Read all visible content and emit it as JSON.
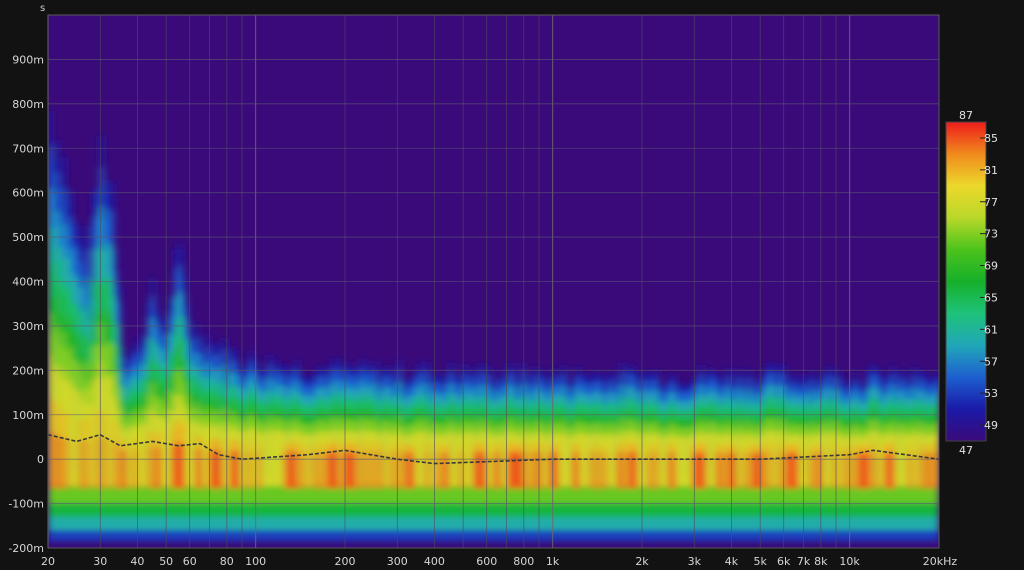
{
  "chart_data": {
    "type": "heatmap",
    "title": "",
    "y_unit": "s",
    "x_unit": "kHz",
    "xscale": "log",
    "xlim": [
      20,
      20000
    ],
    "ylim": [
      -0.2,
      1.0
    ],
    "grid": true,
    "x_ticks": [
      {
        "value": 20,
        "label": "20"
      },
      {
        "value": 30,
        "label": "30"
      },
      {
        "value": 40,
        "label": "40"
      },
      {
        "value": 50,
        "label": "50"
      },
      {
        "value": 60,
        "label": "60"
      },
      {
        "value": 80,
        "label": "80"
      },
      {
        "value": 100,
        "label": "100"
      },
      {
        "value": 200,
        "label": "200"
      },
      {
        "value": 300,
        "label": "300"
      },
      {
        "value": 400,
        "label": "400"
      },
      {
        "value": 600,
        "label": "600"
      },
      {
        "value": 800,
        "label": "800"
      },
      {
        "value": 1000,
        "label": "1k"
      },
      {
        "value": 2000,
        "label": "2k"
      },
      {
        "value": 3000,
        "label": "3k"
      },
      {
        "value": 4000,
        "label": "4k"
      },
      {
        "value": 5000,
        "label": "5k"
      },
      {
        "value": 6000,
        "label": "6k"
      },
      {
        "value": 7000,
        "label": "7k"
      },
      {
        "value": 8000,
        "label": "8k"
      },
      {
        "value": 10000,
        "label": "10k"
      },
      {
        "value": 20000,
        "label": "20kHz"
      }
    ],
    "y_ticks": [
      {
        "value": 0.9,
        "label": "900m"
      },
      {
        "value": 0.8,
        "label": "800m"
      },
      {
        "value": 0.7,
        "label": "700m"
      },
      {
        "value": 0.6,
        "label": "600m"
      },
      {
        "value": 0.5,
        "label": "500m"
      },
      {
        "value": 0.4,
        "label": "400m"
      },
      {
        "value": 0.3,
        "label": "300m"
      },
      {
        "value": 0.2,
        "label": "200m"
      },
      {
        "value": 0.1,
        "label": "100m"
      },
      {
        "value": 0.0,
        "label": "0"
      },
      {
        "value": -0.1,
        "label": "-100m"
      },
      {
        "value": -0.2,
        "label": "-200m"
      }
    ],
    "color_scale": {
      "min": 47,
      "max": 87,
      "labels": [
        "87",
        "85",
        "81",
        "77",
        "73",
        "69",
        "65",
        "61",
        "57",
        "53",
        "49",
        "47"
      ],
      "stops": [
        {
          "value": 47,
          "color": "#3a0a7a"
        },
        {
          "value": 51,
          "color": "#1a1aa8"
        },
        {
          "value": 55,
          "color": "#1d5fcf"
        },
        {
          "value": 59,
          "color": "#21a7b8"
        },
        {
          "value": 63,
          "color": "#1ec27a"
        },
        {
          "value": 67,
          "color": "#16b02a"
        },
        {
          "value": 71,
          "color": "#4cc31c"
        },
        {
          "value": 75,
          "color": "#b9d82a"
        },
        {
          "value": 79,
          "color": "#ecd82b"
        },
        {
          "value": 83,
          "color": "#f08a1d"
        },
        {
          "value": 87,
          "color": "#ee1c1c"
        }
      ]
    },
    "ridge_envelope": [
      {
        "freq": 20,
        "top": 0.8
      },
      {
        "freq": 22,
        "top": 0.7
      },
      {
        "freq": 25,
        "top": 0.5
      },
      {
        "freq": 28,
        "top": 0.45
      },
      {
        "freq": 30,
        "top": 0.7
      },
      {
        "freq": 33,
        "top": 0.6
      },
      {
        "freq": 36,
        "top": 0.22
      },
      {
        "freq": 40,
        "top": 0.25
      },
      {
        "freq": 45,
        "top": 0.36
      },
      {
        "freq": 50,
        "top": 0.3
      },
      {
        "freq": 55,
        "top": 0.45
      },
      {
        "freq": 60,
        "top": 0.3
      },
      {
        "freq": 70,
        "top": 0.27
      },
      {
        "freq": 80,
        "top": 0.24
      },
      {
        "freq": 100,
        "top": 0.22
      },
      {
        "freq": 200,
        "top": 0.2
      },
      {
        "freq": 1000,
        "top": 0.19
      },
      {
        "freq": 10000,
        "top": 0.19
      },
      {
        "freq": 20000,
        "top": 0.18
      }
    ],
    "peak_time_curve": [
      {
        "freq": 20,
        "t": 0.055
      },
      {
        "freq": 25,
        "t": 0.04
      },
      {
        "freq": 30,
        "t": 0.055
      },
      {
        "freq": 35,
        "t": 0.03
      },
      {
        "freq": 45,
        "t": 0.04
      },
      {
        "freq": 55,
        "t": 0.03
      },
      {
        "freq": 65,
        "t": 0.035
      },
      {
        "freq": 75,
        "t": 0.01
      },
      {
        "freq": 90,
        "t": 0.0
      },
      {
        "freq": 150,
        "t": 0.01
      },
      {
        "freq": 200,
        "t": 0.02
      },
      {
        "freq": 300,
        "t": 0.0
      },
      {
        "freq": 400,
        "t": -0.01
      },
      {
        "freq": 1000,
        "t": 0.0
      },
      {
        "freq": 5000,
        "t": 0.0
      },
      {
        "freq": 10000,
        "t": 0.01
      },
      {
        "freq": 12000,
        "t": 0.02
      },
      {
        "freq": 20000,
        "t": 0.0
      }
    ]
  }
}
